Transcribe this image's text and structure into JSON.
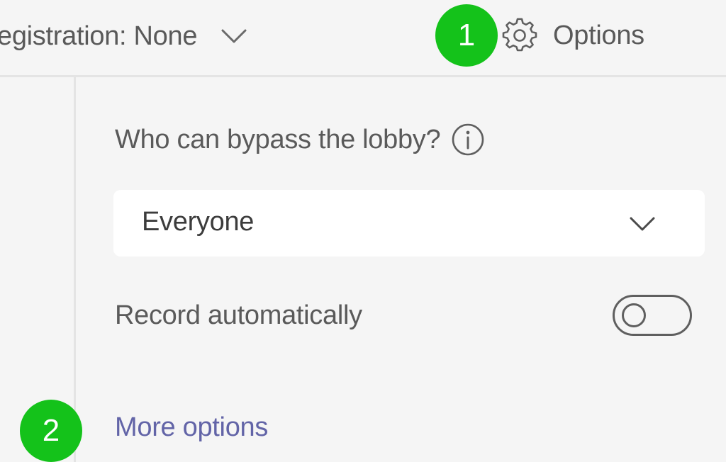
{
  "header": {
    "registration_label": "egistration: None",
    "options_label": "Options"
  },
  "annotations": {
    "badge_1": "1",
    "badge_2": "2"
  },
  "panel": {
    "lobby_question": "Who can bypass the lobby?",
    "lobby_dropdown_value": "Everyone",
    "record_label": "Record automatically",
    "record_enabled": false,
    "more_options_link": "More options"
  },
  "icons": {
    "registration_chevron": "chevron-down-icon",
    "settings": "gear-icon",
    "info": "info-icon",
    "dropdown_chevron": "chevron-down-icon"
  },
  "colors": {
    "annotation_badge": "#14c21a",
    "link": "#6264a7",
    "background": "#f5f5f5"
  }
}
